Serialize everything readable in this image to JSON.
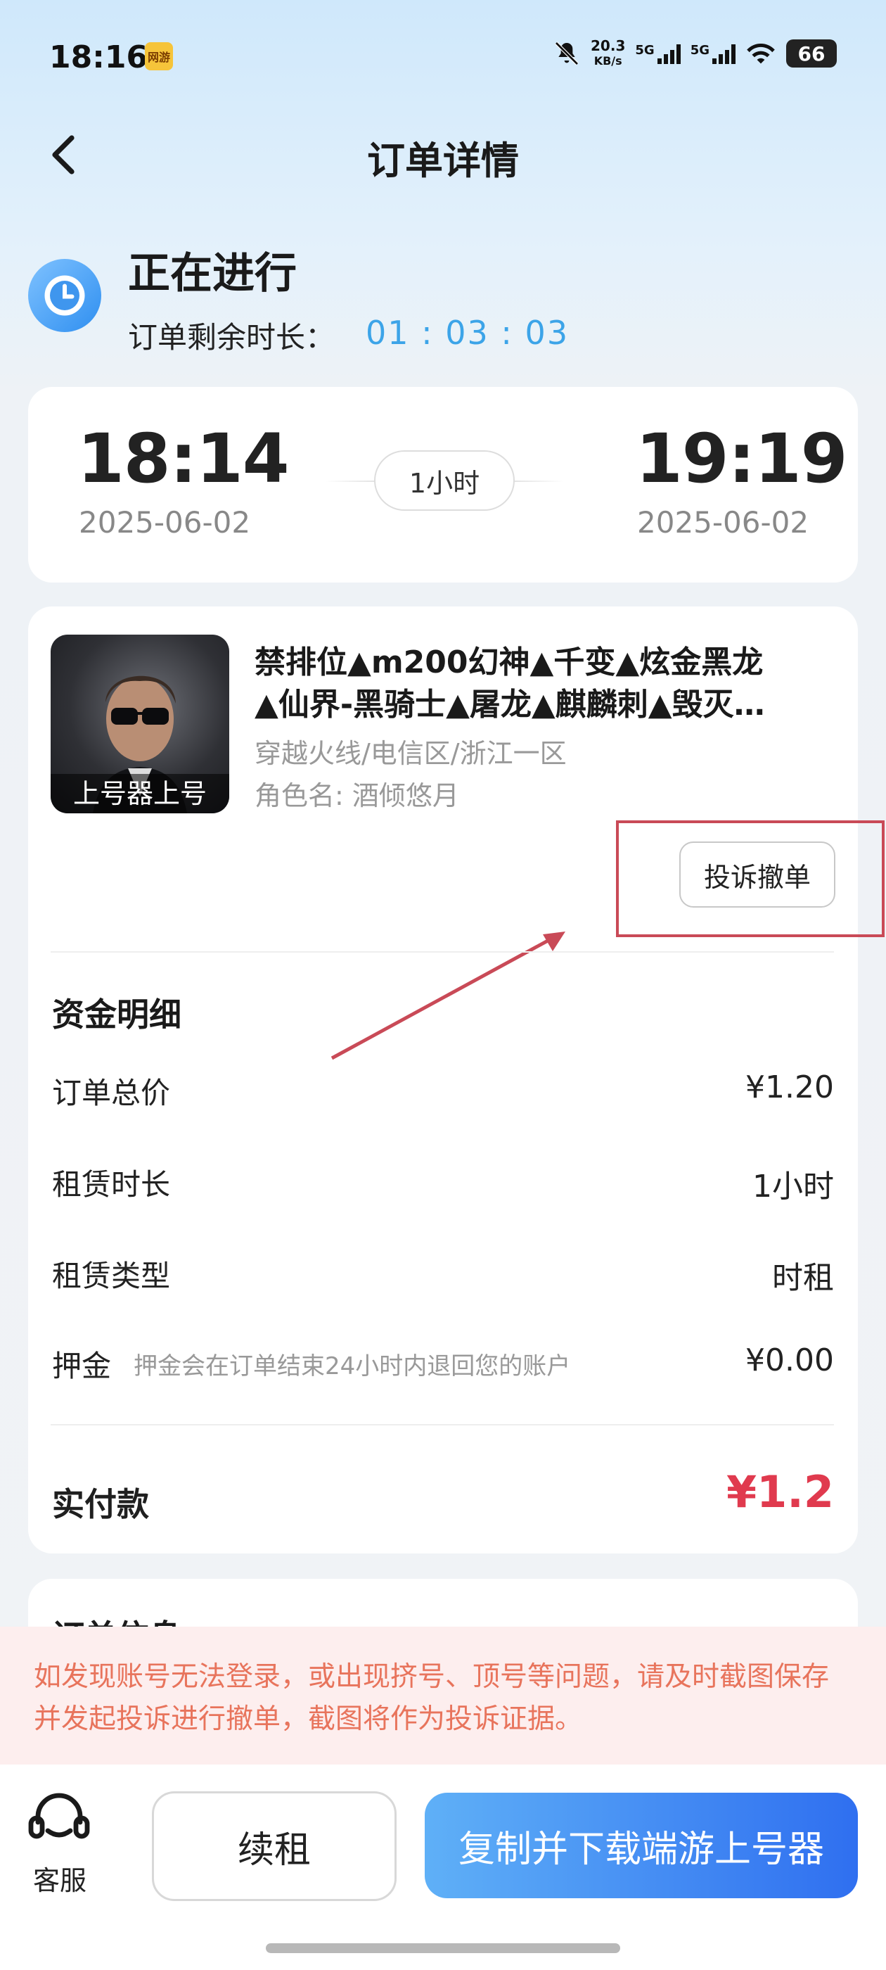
{
  "status_bar": {
    "time": "18:16",
    "app_icon": "网游",
    "speed_value": "20.3",
    "speed_unit": "KB/s",
    "sig1": "5G",
    "sig2": "5G",
    "battery": "66"
  },
  "header": {
    "title": "订单详情"
  },
  "order_status": {
    "title": "正在进行",
    "remaining_label": "订单剩余时长：",
    "remaining_value": "01 : 03 : 03"
  },
  "time_card": {
    "start_time": "18:14",
    "start_date": "2025-06-02",
    "duration": "1小时",
    "end_time": "19:19",
    "end_date": "2025-06-02"
  },
  "game": {
    "thumb_label": "上号器上号",
    "title_line1": "禁排位▲m200幻神▲千变▲炫金黑龙",
    "title_line2": "▲仙界-黑骑士▲屠龙▲麒麟刺▲毁灭…",
    "region": "穿越火线/电信区/浙江一区",
    "role": "角色名: 酒倾悠月",
    "complain_button": "投诉撤单"
  },
  "funds": {
    "title": "资金明细",
    "rows": [
      {
        "label": "订单总价",
        "value": "¥1.20"
      },
      {
        "label": "租赁时长",
        "value": "1小时"
      },
      {
        "label": "租赁类型",
        "value": "时租"
      },
      {
        "label": "押金",
        "value": "¥0.00",
        "note": "押金会在订单结束24小时内退回您的账户"
      }
    ],
    "paid_label": "实付款",
    "paid_value": "¥1.2"
  },
  "order_info": {
    "title": "订单信息"
  },
  "warning": "如发现账号无法登录，或出现挤号、顶号等问题，请及时截图保存并发起投诉进行撤单，截图将作为投诉证据。",
  "bottom": {
    "service_label": "客服",
    "renew_button": "续租",
    "copy_button": "复制并下载端游上号器"
  },
  "colors": {
    "accent_blue": "#3ca4e8",
    "price_red": "#e03a4e",
    "annotation_red": "#c94a57",
    "warning_text": "#e8745c"
  }
}
